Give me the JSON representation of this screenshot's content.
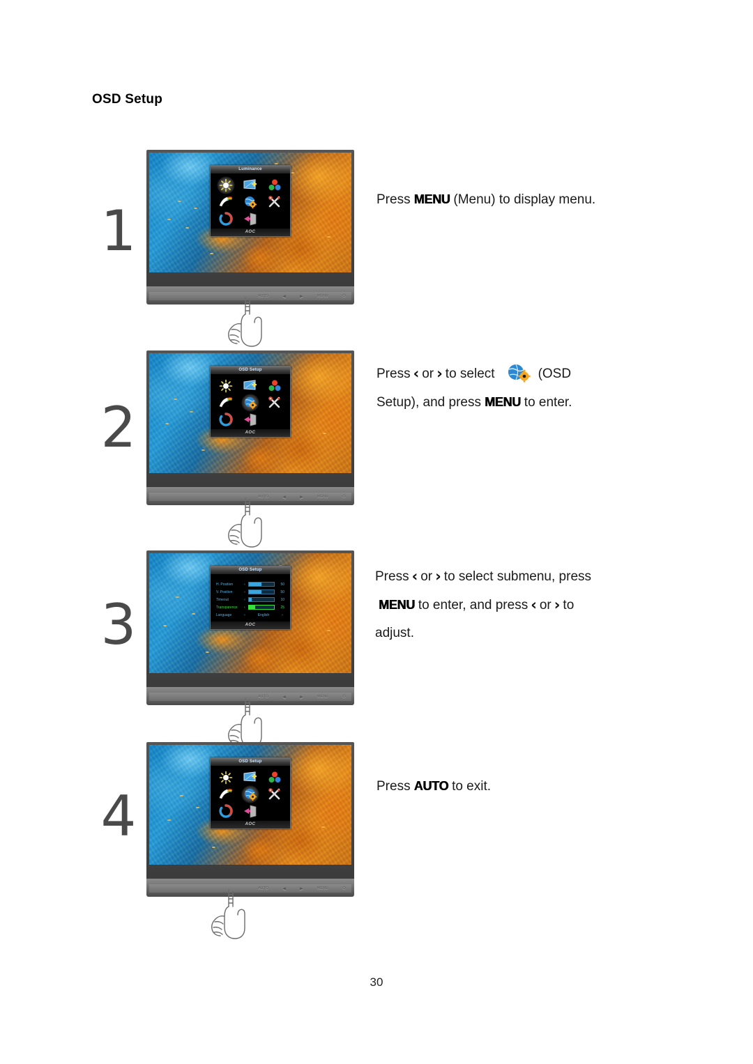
{
  "document": {
    "section_title": "OSD Setup",
    "page_number": "30"
  },
  "keys": {
    "menu": "MENU",
    "auto": "AUTO",
    "left_chevron": "‹",
    "right_chevron": "›"
  },
  "monitor": {
    "brand_logo": "AOC",
    "bezel_buttons": [
      {
        "name": "auto-button",
        "label": "AUTO"
      },
      {
        "name": "left-button",
        "label": "◀"
      },
      {
        "name": "right-button",
        "label": "▶"
      },
      {
        "name": "menu-button",
        "label": "MENU"
      },
      {
        "name": "power-button",
        "label": "⏻"
      }
    ],
    "main_menu_title": "Luminance",
    "osd_setup_title": "OSD Setup",
    "icons": [
      {
        "name": "luminance-icon",
        "label": "Luminance"
      },
      {
        "name": "image-setup-icon",
        "label": "Image Setup"
      },
      {
        "name": "color-setup-icon",
        "label": "Color Setup"
      },
      {
        "name": "picture-boost-icon",
        "label": "Picture Boost"
      },
      {
        "name": "osd-setup-icon",
        "label": "OSD Setup"
      },
      {
        "name": "extra-icon",
        "label": "Extra"
      },
      {
        "name": "reset-icon",
        "label": "Reset"
      },
      {
        "name": "exit-icon",
        "label": "Exit"
      }
    ],
    "osd_submenu": [
      {
        "label": "H. Position",
        "value": "50",
        "fill": 50,
        "active": false
      },
      {
        "label": "V. Position",
        "value": "50",
        "fill": 50,
        "active": false
      },
      {
        "label": "Timeout",
        "value": "10",
        "fill": 12,
        "active": false
      },
      {
        "label": "Transparence",
        "value": "25",
        "fill": 25,
        "active": true
      },
      {
        "label": "Language",
        "value": "English",
        "option": true,
        "active": false
      }
    ]
  },
  "steps": [
    {
      "number": "1",
      "text_parts": [
        {
          "type": "text",
          "value": "Press "
        },
        {
          "type": "key",
          "value": "MENU"
        },
        {
          "type": "text",
          "value": " (Menu) to display menu."
        }
      ]
    },
    {
      "number": "2",
      "text_parts": [
        {
          "type": "text",
          "value": "Press "
        },
        {
          "type": "chevron",
          "value": "‹"
        },
        {
          "type": "text",
          "value": " or "
        },
        {
          "type": "chevron",
          "value": "›"
        },
        {
          "type": "text",
          "value": " to select "
        },
        {
          "type": "icon",
          "value": "osd-setup-globe-icon"
        },
        {
          "type": "text",
          "value": " (OSD Setup), and press "
        },
        {
          "type": "key",
          "value": "MENU"
        },
        {
          "type": "text",
          "value": " to enter."
        }
      ]
    },
    {
      "number": "3",
      "text_parts": [
        {
          "type": "text",
          "value": "Press "
        },
        {
          "type": "chevron",
          "value": "‹"
        },
        {
          "type": "text",
          "value": " or "
        },
        {
          "type": "chevron",
          "value": "›"
        },
        {
          "type": "text",
          "value": " to select submenu, press "
        },
        {
          "type": "key",
          "value": "MENU"
        },
        {
          "type": "text",
          "value": " to enter, and press "
        },
        {
          "type": "chevron",
          "value": "‹"
        },
        {
          "type": "text",
          "value": " or "
        },
        {
          "type": "chevron",
          "value": "›"
        },
        {
          "type": "text",
          "value": " to adjust."
        }
      ]
    },
    {
      "number": "4",
      "text_parts": [
        {
          "type": "text",
          "value": "Press "
        },
        {
          "type": "key",
          "value": "AUTO"
        },
        {
          "type": "text",
          "value": " to exit."
        }
      ]
    }
  ],
  "step_text": {
    "s1_a": "Press",
    "s1_b": "(Menu) to display menu.",
    "s2_a": "Press",
    "s2_or": "or",
    "s2_b": "to select",
    "s2_c": "(OSD",
    "s2_d": "Setup), and press",
    "s2_e": "to enter.",
    "s3_a": "Press",
    "s3_or": "or",
    "s3_b": "to select submenu, press",
    "s3_c": "to enter, and press",
    "s3_or2": "or",
    "s3_d": "to",
    "s3_e": "adjust.",
    "s4_a": "Press",
    "s4_b": "to exit."
  },
  "colors": {
    "accent_blue": "#39a6e0",
    "highlight_green": "#35e03a",
    "gear_orange": "#f5a623",
    "globe_blue": "#2c87d4",
    "bezel_gray": "#6d6d6d"
  }
}
